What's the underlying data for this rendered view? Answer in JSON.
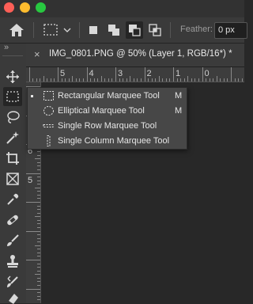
{
  "window": {
    "traffic_lights": {
      "close": "#fd5f57",
      "minimize": "#febc2e",
      "zoom": "#28c840"
    }
  },
  "options_bar": {
    "feather_label": "Feather:",
    "feather_value": "0 px"
  },
  "document_tab": {
    "close_symbol": "×",
    "title": "IMG_0801.PNG @ 50% (Layer 1, RGB/16*) *"
  },
  "ruler": {
    "horizontal_labels": [
      "5",
      "4",
      "3",
      "2",
      "1",
      "0"
    ],
    "vertical_labels": [
      "6",
      "5"
    ]
  },
  "toolbox": {
    "collapse_glyph": "»",
    "tools": [
      {
        "name": "move-tool",
        "icon": "move-icon"
      },
      {
        "name": "rectangular-marquee-tool",
        "icon": "marquee-rect-icon",
        "selected": true
      },
      {
        "name": "lasso-tool",
        "icon": "lasso-icon"
      },
      {
        "name": "magic-wand-tool",
        "icon": "magic-wand-icon"
      },
      {
        "name": "crop-tool",
        "icon": "crop-icon"
      },
      {
        "name": "frame-tool",
        "icon": "frame-icon"
      },
      {
        "name": "eyedropper-tool",
        "icon": "eyedropper-icon"
      },
      {
        "name": "healing-brush-tool",
        "icon": "bandage-icon"
      },
      {
        "name": "brush-tool",
        "icon": "brush-icon"
      },
      {
        "name": "clone-stamp-tool",
        "icon": "stamp-icon"
      },
      {
        "name": "history-brush-tool",
        "icon": "history-brush-icon"
      }
    ]
  },
  "marquee_flyout": {
    "items": [
      {
        "label": "Rectangular Marquee Tool",
        "shortcut": "M",
        "active": true
      },
      {
        "label": "Elliptical Marquee Tool",
        "shortcut": "M",
        "active": false
      },
      {
        "label": "Single Row Marquee Tool",
        "shortcut": "",
        "active": false
      },
      {
        "label": "Single Column Marquee Tool",
        "shortcut": "",
        "active": false
      }
    ]
  }
}
